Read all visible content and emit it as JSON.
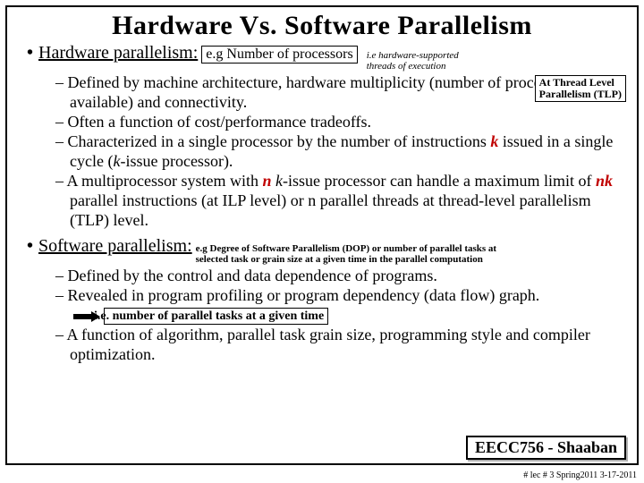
{
  "title": "Hardware Vs. Software Parallelism",
  "hw": {
    "bullet": "•",
    "heading": "Hardware parallelism:",
    "box": "e.g Number of processors",
    "sidenote1": "i.e hardware-supported",
    "sidenote2": "threads of execution",
    "aside1": "At Thread Level",
    "aside2": "Parallelism (TLP)",
    "items": [
      "Defined by machine architecture, hardware multiplicity (number of processors available) and connectivity.",
      "Often a function of cost/performance tradeoffs.",
      "Characterized in a single processor by the number of instructions <span class='k'>k</span> issued in a single cycle (<span class='ki'>k</span>-issue processor).",
      "A multiprocessor system with  <span class='n'>n</span>  <span class='ki'>k</span>-issue processor can handle a maximum limit of <span class='nk'>nk</span>  parallel instructions (at ILP level) or n parallel threads at thread-level parallelism (TLP) level."
    ]
  },
  "sw": {
    "bullet": "•",
    "heading": "Software parallelism:",
    "note1": "e.g Degree of Software Parallelism (DOP) or number of parallel tasks at",
    "note2": "selected task or grain size at a given time in the parallel computation",
    "items": [
      "Defined by the control and data dependence of programs.",
      "Revealed in program profiling or program dependency (data flow) graph.",
      "A function of algorithm, parallel task grain size, programming style and compiler optimization."
    ],
    "arrowNote": "i.e. number of parallel tasks at a given time"
  },
  "foot": {
    "course": "EECC756 - Shaaban",
    "meta": "#  lec # 3   Spring2011  3-17-2011"
  }
}
